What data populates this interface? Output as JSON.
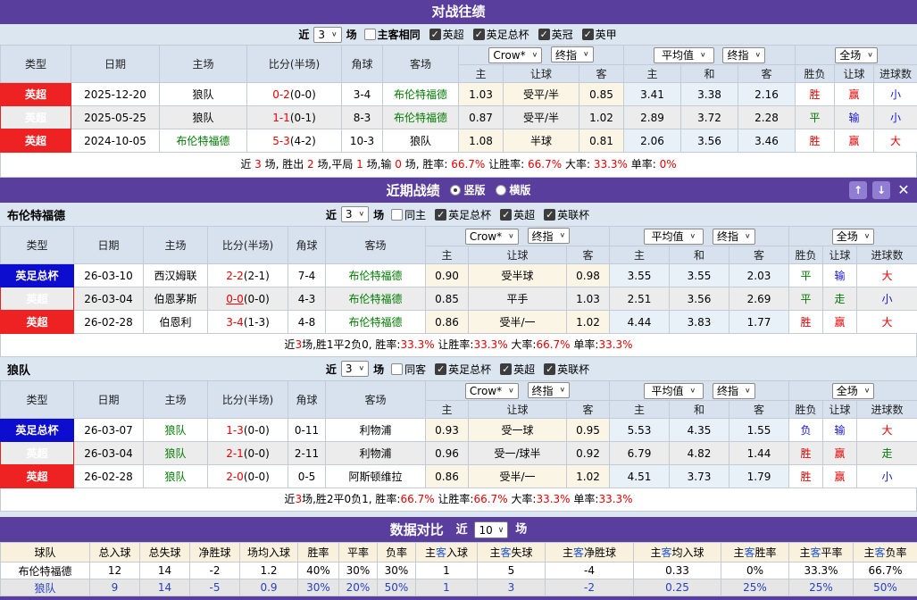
{
  "table_headers": {
    "type": "类型",
    "date": "日期",
    "home": "主场",
    "score": "比分(半场)",
    "corner": "角球",
    "away": "客场",
    "sub": {
      "o_home": "主",
      "handicap": "让球",
      "o_away": "客",
      "avg_home": "主",
      "avg_draw": "和",
      "avg_away": "客",
      "result": "胜负",
      "h_result": "让球",
      "goals": "进球数"
    }
  },
  "selects": {
    "crow": "Crow*",
    "final": "终指",
    "avg": "平均值",
    "scope": "全场"
  },
  "h2h": {
    "title": "对战往绩",
    "filter": {
      "prefix": "近",
      "count": "3",
      "suffix": "场",
      "same": {
        "label": "主客相同",
        "checked": false
      },
      "leagues": [
        {
          "label": "英超",
          "checked": true
        },
        {
          "label": "英足总杯",
          "checked": true
        },
        {
          "label": "英冠",
          "checked": true
        },
        {
          "label": "英甲",
          "checked": true
        }
      ]
    },
    "rows": [
      {
        "type": "英超",
        "type_c": "red",
        "date": "2025-12-20",
        "home": "狼队",
        "home_c": "black",
        "score": "0-2",
        "half": "(0-0)",
        "u": "0",
        "corner": "3-4",
        "away": "布伦特福德",
        "away_c": "green",
        "o1": "1.03",
        "o2": "受平/半",
        "o3": "0.85",
        "a1": "3.41",
        "a2": "3.38",
        "a3": "2.16",
        "r1": "胜",
        "r1c": "red",
        "r2": "赢",
        "r2c": "red",
        "r3": "小",
        "r3c": "blue"
      },
      {
        "type": "英超",
        "type_c": "red",
        "date": "2025-05-25",
        "home": "狼队",
        "home_c": "black",
        "score": "1-1",
        "half": "(0-1)",
        "u": "0",
        "corner": "8-3",
        "away": "布伦特福德",
        "away_c": "green",
        "o1": "0.87",
        "o2": "受平/半",
        "o3": "1.02",
        "a1": "2.89",
        "a2": "3.72",
        "a3": "2.28",
        "r1": "平",
        "r1c": "green",
        "r2": "输",
        "r2c": "blue",
        "r3": "小",
        "r3c": "blue"
      },
      {
        "type": "英超",
        "type_c": "red",
        "date": "2024-10-05",
        "home": "布伦特福德",
        "home_c": "green",
        "score": "5-3",
        "half": "(4-2)",
        "u": "0",
        "corner": "10-3",
        "away": "狼队",
        "away_c": "black",
        "o1": "1.08",
        "o2": "半球",
        "o3": "0.81",
        "a1": "2.06",
        "a2": "3.56",
        "a3": "3.46",
        "r1": "胜",
        "r1c": "red",
        "r2": "赢",
        "r2c": "red",
        "r3": "大",
        "r3c": "red"
      }
    ],
    "summary": [
      {
        "t": "近 "
      },
      {
        "t": "3",
        "c": "red"
      },
      {
        "t": " 场, 胜出 "
      },
      {
        "t": "2",
        "c": "red"
      },
      {
        "t": " 场,平局 "
      },
      {
        "t": "1",
        "c": "red"
      },
      {
        "t": " 场,输 "
      },
      {
        "t": "0",
        "c": "red"
      },
      {
        "t": " 场, 胜率: "
      },
      {
        "t": "66.7%",
        "c": "red"
      },
      {
        "t": " 让胜率: "
      },
      {
        "t": "66.7%",
        "c": "red"
      },
      {
        "t": " 大率: "
      },
      {
        "t": "33.3%",
        "c": "red"
      },
      {
        "t": " 单率: "
      },
      {
        "t": "0%",
        "c": "red"
      }
    ]
  },
  "recent": {
    "title": "近期战绩",
    "radios": [
      {
        "label": "竖版",
        "checked": true
      },
      {
        "label": "横版",
        "checked": false
      }
    ],
    "buttons": {
      "up": "↑",
      "down": "↓",
      "close": "✕"
    }
  },
  "brentford": {
    "team": "布伦特福德",
    "filter": {
      "prefix": "近",
      "count": "3",
      "suffix": "场",
      "same": {
        "label": "同主",
        "checked": false
      },
      "leagues": [
        {
          "label": "英足总杯",
          "checked": true
        },
        {
          "label": "英超",
          "checked": true
        },
        {
          "label": "英联杯",
          "checked": true
        }
      ]
    },
    "rows": [
      {
        "type": "英足总杯",
        "type_c": "blue",
        "date": "26-03-10",
        "home": "西汉姆联",
        "home_c": "black",
        "score": "2-2",
        "half": "(2-1)",
        "u": "0",
        "corner": "7-4",
        "away": "布伦特福德",
        "away_c": "green",
        "o1": "0.90",
        "o2": "受半球",
        "o3": "0.98",
        "a1": "3.55",
        "a2": "3.55",
        "a3": "2.03",
        "r1": "平",
        "r1c": "green",
        "r2": "输",
        "r2c": "blue",
        "r3": "大",
        "r3c": "red"
      },
      {
        "type": "英超",
        "type_c": "red",
        "date": "26-03-04",
        "home": "伯恩茅斯",
        "home_c": "black",
        "score": "0-0",
        "half": "(0-0)",
        "u": "1",
        "corner": "4-3",
        "away": "布伦特福德",
        "away_c": "green",
        "o1": "0.85",
        "o2": "平手",
        "o3": "1.03",
        "a1": "2.51",
        "a2": "3.56",
        "a3": "2.69",
        "r1": "平",
        "r1c": "green",
        "r2": "走",
        "r2c": "green",
        "r3": "小",
        "r3c": "blue"
      },
      {
        "type": "英超",
        "type_c": "red",
        "date": "26-02-28",
        "home": "伯恩利",
        "home_c": "black",
        "score": "3-4",
        "half": "(1-3)",
        "u": "0",
        "corner": "4-8",
        "away": "布伦特福德",
        "away_c": "green",
        "o1": "0.86",
        "o2": "受半/一",
        "o3": "1.02",
        "a1": "4.44",
        "a2": "3.83",
        "a3": "1.77",
        "r1": "胜",
        "r1c": "red",
        "r2": "赢",
        "r2c": "red",
        "r3": "大",
        "r3c": "red"
      }
    ],
    "summary": [
      {
        "t": "近"
      },
      {
        "t": "3",
        "c": "red"
      },
      {
        "t": "场,胜1平2负0, 胜率:"
      },
      {
        "t": "33.3%",
        "c": "red"
      },
      {
        "t": " 让胜率:"
      },
      {
        "t": "33.3%",
        "c": "red"
      },
      {
        "t": " 大率:"
      },
      {
        "t": "66.7%",
        "c": "red"
      },
      {
        "t": " 单率:"
      },
      {
        "t": "33.3%",
        "c": "red"
      }
    ]
  },
  "wolves": {
    "team": "狼队",
    "filter": {
      "prefix": "近",
      "count": "3",
      "suffix": "场",
      "same": {
        "label": "同客",
        "checked": false
      },
      "leagues": [
        {
          "label": "英足总杯",
          "checked": true
        },
        {
          "label": "英超",
          "checked": true
        },
        {
          "label": "英联杯",
          "checked": true
        }
      ]
    },
    "rows": [
      {
        "type": "英足总杯",
        "type_c": "blue",
        "date": "26-03-07",
        "home": "狼队",
        "home_c": "green",
        "score": "1-3",
        "half": "(0-0)",
        "u": "0",
        "corner": "0-11",
        "away": "利物浦",
        "away_c": "black",
        "o1": "0.93",
        "o2": "受一球",
        "o3": "0.95",
        "a1": "5.53",
        "a2": "4.35",
        "a3": "1.55",
        "r1": "负",
        "r1c": "blue",
        "r2": "输",
        "r2c": "blue",
        "r3": "大",
        "r3c": "red"
      },
      {
        "type": "英超",
        "type_c": "red",
        "date": "26-03-04",
        "home": "狼队",
        "home_c": "green",
        "score": "2-1",
        "half": "(0-0)",
        "u": "0",
        "corner": "2-11",
        "away": "利物浦",
        "away_c": "black",
        "o1": "0.96",
        "o2": "受一/球半",
        "o3": "0.92",
        "a1": "6.79",
        "a2": "4.82",
        "a3": "1.44",
        "r1": "胜",
        "r1c": "red",
        "r2": "赢",
        "r2c": "red",
        "r3": "走",
        "r3c": "green"
      },
      {
        "type": "英超",
        "type_c": "red",
        "date": "26-02-28",
        "home": "狼队",
        "home_c": "green",
        "score": "2-0",
        "half": "(0-0)",
        "u": "0",
        "corner": "0-5",
        "away": "阿斯顿维拉",
        "away_c": "black",
        "o1": "0.86",
        "o2": "受半/一",
        "o3": "1.02",
        "a1": "4.51",
        "a2": "3.73",
        "a3": "1.79",
        "r1": "胜",
        "r1c": "red",
        "r2": "赢",
        "r2c": "red",
        "r3": "小",
        "r3c": "blue"
      }
    ],
    "summary": [
      {
        "t": "近"
      },
      {
        "t": "3",
        "c": "red"
      },
      {
        "t": "场,胜2平0负1, 胜率:"
      },
      {
        "t": "66.7%",
        "c": "red"
      },
      {
        "t": " 让胜率:"
      },
      {
        "t": "66.7%",
        "c": "red"
      },
      {
        "t": " 大率:"
      },
      {
        "t": "33.3%",
        "c": "red"
      },
      {
        "t": " 单率:"
      },
      {
        "t": "33.3%",
        "c": "red"
      }
    ]
  },
  "comparison": {
    "title": "数据对比",
    "filter": {
      "prefix": "近",
      "count": "10",
      "suffix": "场"
    },
    "headers": [
      [
        {
          "t": "球队"
        }
      ],
      [
        {
          "t": "总入球"
        }
      ],
      [
        {
          "t": "总失球"
        }
      ],
      [
        {
          "t": "净胜球"
        }
      ],
      [
        {
          "t": "场均入球"
        }
      ],
      [
        {
          "t": "胜率"
        }
      ],
      [
        {
          "t": "平率"
        }
      ],
      [
        {
          "t": "负率"
        }
      ],
      [
        {
          "t": "主"
        },
        {
          "t": "客",
          "c": "blue"
        },
        {
          "t": "入球"
        }
      ],
      [
        {
          "t": "主"
        },
        {
          "t": "客",
          "c": "blue"
        },
        {
          "t": "失球"
        }
      ],
      [
        {
          "t": "主"
        },
        {
          "t": "客",
          "c": "blue"
        },
        {
          "t": "净胜球"
        }
      ],
      [
        {
          "t": "主"
        },
        {
          "t": "客",
          "c": "blue"
        },
        {
          "t": "均入球"
        }
      ],
      [
        {
          "t": "主"
        },
        {
          "t": "客",
          "c": "blue"
        },
        {
          "t": "胜率"
        }
      ],
      [
        {
          "t": "主"
        },
        {
          "t": "客",
          "c": "blue"
        },
        {
          "t": "平率"
        }
      ],
      [
        {
          "t": "主"
        },
        {
          "t": "客",
          "c": "blue"
        },
        {
          "t": "负率"
        }
      ]
    ],
    "rows": [
      {
        "team": "布伦特福德",
        "style": "black",
        "values": [
          "12",
          "14",
          "-2",
          "1.2",
          "40%",
          "30%",
          "30%",
          "1",
          "5",
          "-4",
          "0.33",
          "0%",
          "33.3%",
          "66.7%"
        ]
      },
      {
        "team": "狼队",
        "style": "blue",
        "values": [
          "9",
          "14",
          "-5",
          "0.9",
          "30%",
          "20%",
          "50%",
          "1",
          "3",
          "-2",
          "0.25",
          "25%",
          "25%",
          "50%"
        ]
      }
    ]
  }
}
